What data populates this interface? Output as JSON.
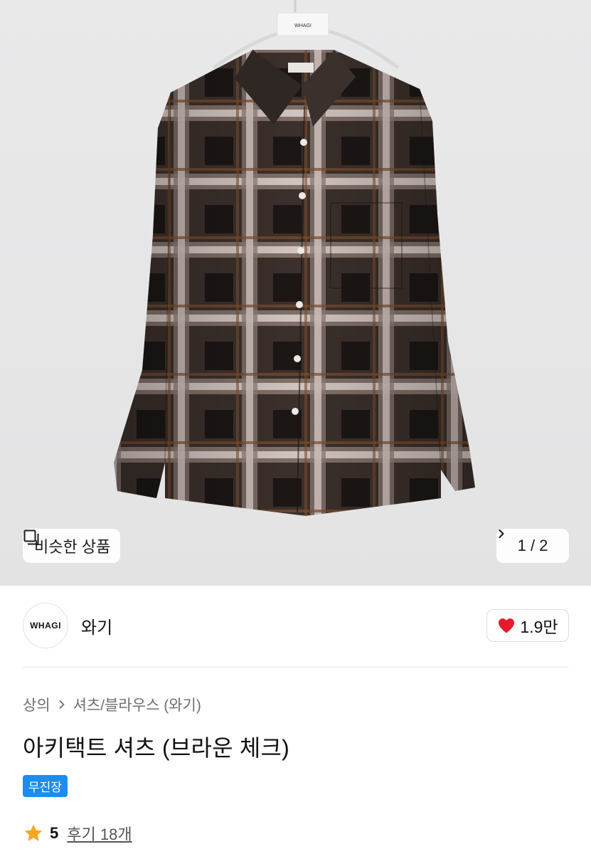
{
  "hero": {
    "similar_label": "비슷한 상품",
    "similar_icon": "similar-items-icon",
    "pager_text": "1 / 2",
    "pager_icon": "chevron-right-icon",
    "hanger_tag": "WHAGI"
  },
  "brand": {
    "logo_text": "WHAGI",
    "name": "와기",
    "likes_label": "1.9만",
    "likes_icon": "heart-icon",
    "heart_color": "#e8192c"
  },
  "breadcrumb": {
    "items": [
      "상의",
      "셔츠/블라우스 (와기)"
    ],
    "separator_icon": "chevron-right-icon"
  },
  "product": {
    "title": "아키택트 셔츠 (브라운 체크)",
    "badge": "무진장",
    "badge_color": "#1b8cf0"
  },
  "rating": {
    "icon": "star-icon",
    "star_color": "#f5a623",
    "value": "5",
    "reviews_label": "후기 18개"
  }
}
